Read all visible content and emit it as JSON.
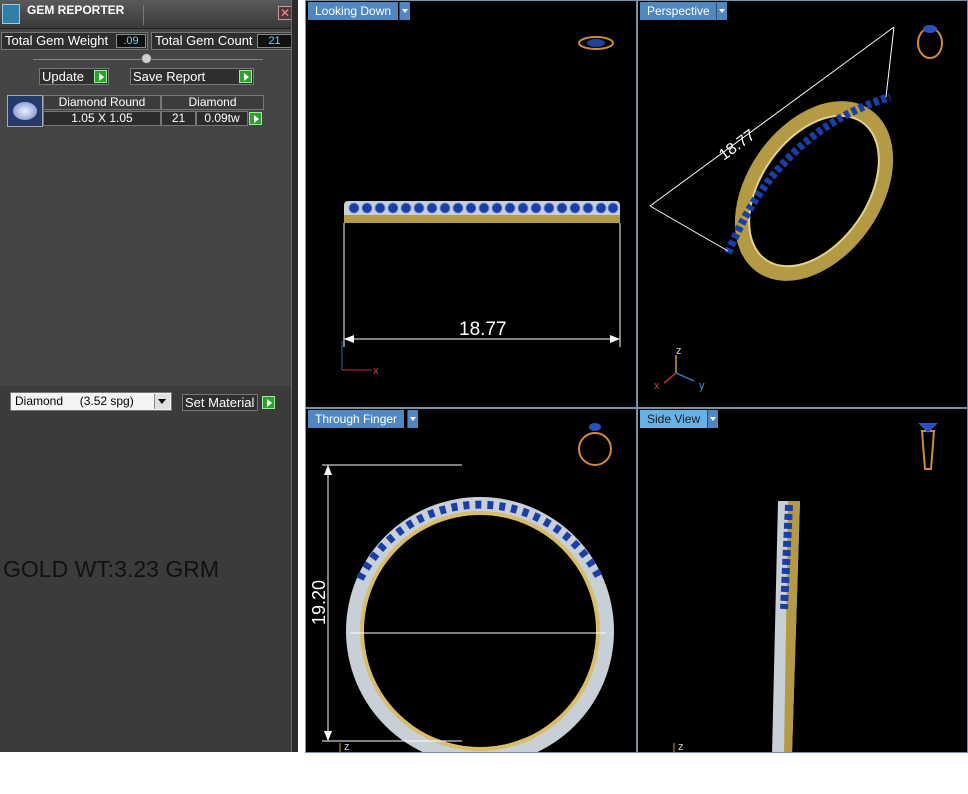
{
  "panel": {
    "title": "GEM REPORTER",
    "close_symbol": "✕",
    "total_gem_weight_label": "Total Gem Weight",
    "total_gem_weight_value": ".09",
    "total_gem_count_label": "Total Gem Count",
    "total_gem_count_value": "21",
    "update_label": "Update",
    "save_report_label": "Save Report",
    "gem_table": {
      "headers": [
        "Diamond Round",
        "Diamond"
      ],
      "row": {
        "size": "1.05 X 1.05",
        "count": "21",
        "weight": "0.09tw"
      }
    },
    "material_select_value": "Diamond     (3.52 spg)",
    "set_material_label": "Set Material",
    "note": "GOLD WT:3.23 GRM"
  },
  "viewports": {
    "looking_down": {
      "label": "Looking Down",
      "dimension": "18.77",
      "axis_x": "x"
    },
    "perspective": {
      "label": "Perspective",
      "dimension": "18.77",
      "axis_z": "z",
      "axis_x": "x",
      "axis_y": "y"
    },
    "through_finger": {
      "label": "Through Finger",
      "dimension": "19.20",
      "axis_z": "z"
    },
    "side_view": {
      "label": "Side View",
      "axis_z": "z"
    }
  },
  "colors": {
    "panel_bg": "#3b3b3b",
    "viewport_bg": "#000000",
    "label_tab": "#4f87c0",
    "active_label_tab": "#66b2e6",
    "gold": "#b59a45",
    "sapphire": "#1a3ea8",
    "white_gold": "#c9cfd6",
    "stat_value": "#6fd6ff"
  }
}
